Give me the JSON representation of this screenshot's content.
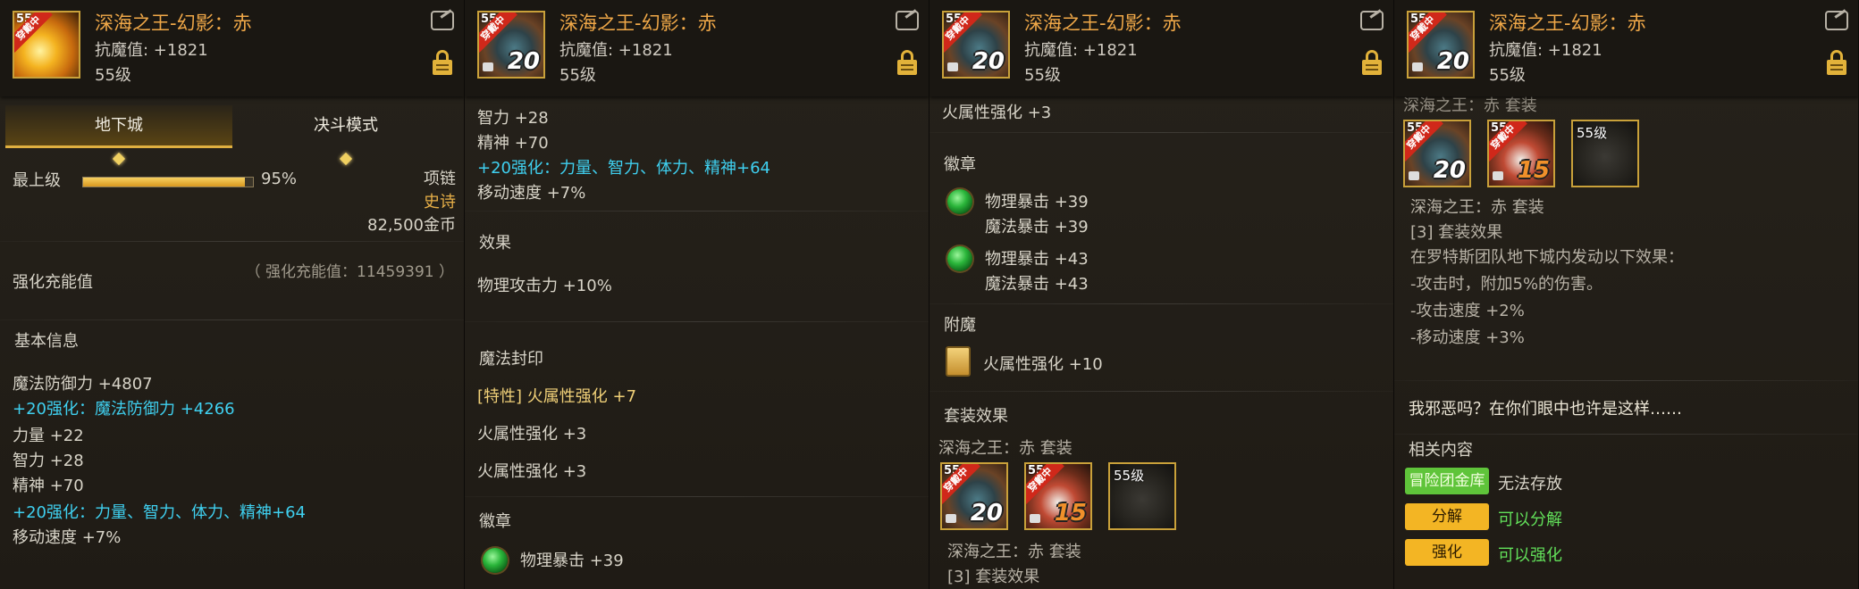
{
  "item": {
    "title": "深海之王-幻影：赤",
    "anti_magic": "抗魔值: +1821",
    "level": "55级",
    "icon_badge": "55",
    "ribbon": "穿戴中",
    "reinforce_20": "20",
    "reinforce_15": "15"
  },
  "panel1": {
    "tabs": [
      "地下城",
      "决斗模式"
    ],
    "grade": "最上级",
    "grade_percent": "95%",
    "grade_fill": 0.95,
    "slot": "项链",
    "rarity": "史诗",
    "price": "82,500金币",
    "charge_title": "强化充能值",
    "charge_value": "（ 强化充能值：11459391 ）",
    "basic_title": "基本信息",
    "lines": [
      "魔法防御力 +4807",
      "+20强化：魔法防御力 +4266",
      "力量 +22",
      "智力 +28",
      "精神 +70",
      "+20强化：力量、智力、体力、精神+64",
      "移动速度 +7%"
    ]
  },
  "panel2": {
    "lines_top": [
      "智力 +28",
      "精神 +70",
      "+20强化：力量、智力、体力、精神+64",
      "移动速度 +7%"
    ],
    "effect_title": "效果",
    "effect": "物理攻击力 +10%",
    "seal_title": "魔法封印",
    "seal_lines": [
      "[特性] 火属性强化 +7",
      "火属性强化 +3",
      "火属性强化 +3"
    ],
    "emblem_title": "徽章",
    "emblem_line": "物理暴击 +39"
  },
  "panel3": {
    "top_line": "火属性强化 +3",
    "emblem_title": "徽章",
    "emblems": [
      [
        "物理暴击 +39",
        "魔法暴击 +39"
      ],
      [
        "物理暴击 +43",
        "魔法暴击 +43"
      ]
    ],
    "enchant_title": "附魔",
    "enchant": "火属性强化 +10",
    "set_title": "套装效果",
    "set_name": "深海之王：赤 套装",
    "set_slot_level": "55级",
    "set_name2": "深海之王：赤 套装",
    "set_effect_cut": "[3] 套装效果"
  },
  "panel4": {
    "set_name_cut": "深海之王：赤 套装",
    "set_slot_level": "55级",
    "set_name": "深海之王：赤 套装",
    "set_effect": "[3] 套装效果",
    "set_lines": [
      "在罗特斯团队地下城内发动以下效果：",
      "-攻击时，附加5%的伤害。",
      "-攻击速度 +2%",
      "-移动速度 +3%"
    ],
    "flavor": "我邪恶吗？在你们眼中也许是这样……",
    "related_title": "相关内容",
    "related": [
      {
        "tag": "冒险团金库",
        "text": "无法存放"
      },
      {
        "tag": "分解",
        "text": "可以分解"
      },
      {
        "tag": "强化",
        "text": "可以强化"
      }
    ]
  },
  "colors": {
    "title": "#f0a848",
    "cyan": "#3fd0f0",
    "gold": "#e8b048",
    "green": "#62e05a"
  },
  "icons": [
    "share-icon",
    "lock-icon",
    "gem-icon",
    "card-icon"
  ]
}
